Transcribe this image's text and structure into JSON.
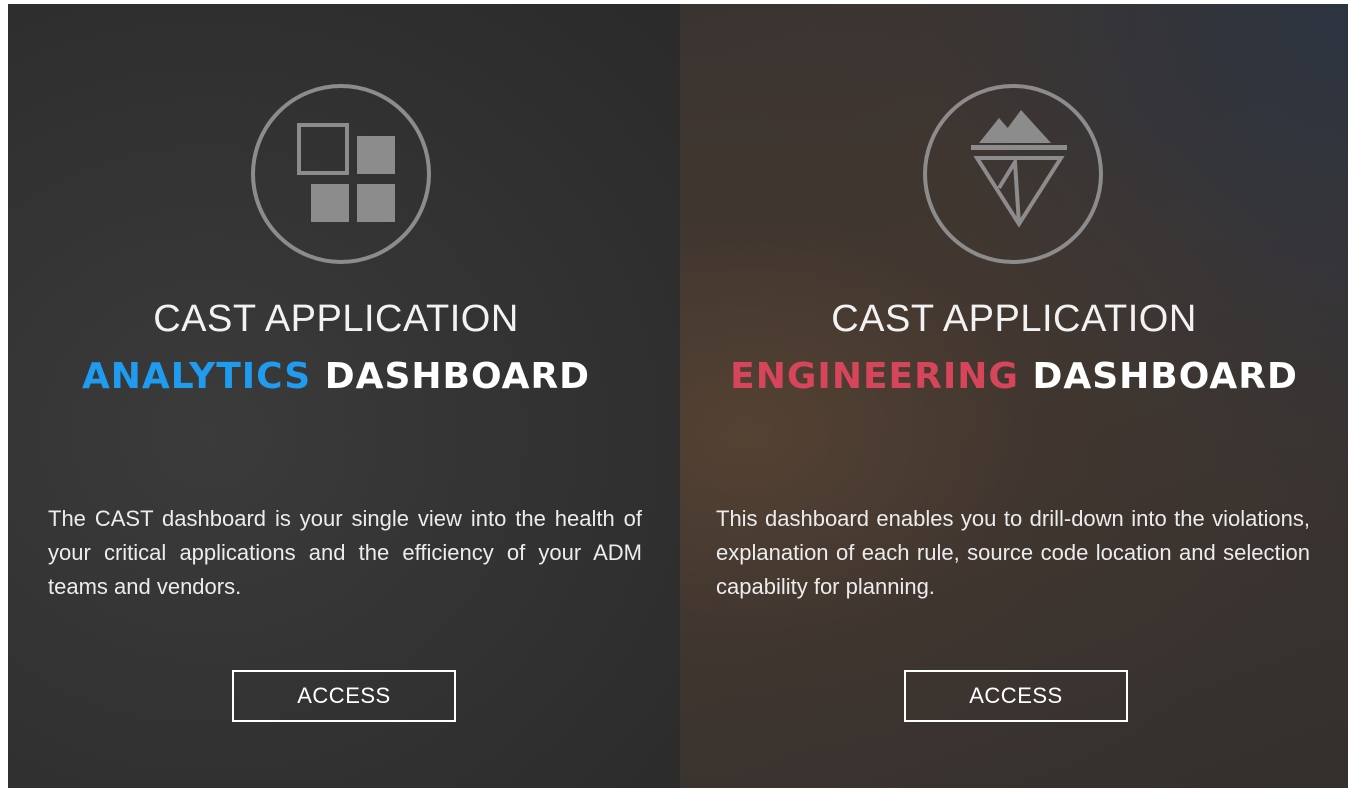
{
  "cards": [
    {
      "icon": "squares-grid-icon",
      "title_line1": "CAST APPLICATION",
      "title_accent": "ANALYTICS",
      "title_suffix": "DASHBOARD",
      "accent_color": "#1f9bf0",
      "description": "The CAST dashboard is your single view into the health of your critical applications and the efficiency of your ADM teams and vendors.",
      "button_label": "ACCESS"
    },
    {
      "icon": "mountain-triangle-icon",
      "title_line1": "CAST APPLICATION",
      "title_accent": "ENGINEERING",
      "title_suffix": "DASHBOARD",
      "accent_color": "#d6455a",
      "description": "This dashboard enables you to drill-down into the violations, explanation of each rule, source code location and selection capability for planning.",
      "button_label": "ACCESS"
    }
  ]
}
